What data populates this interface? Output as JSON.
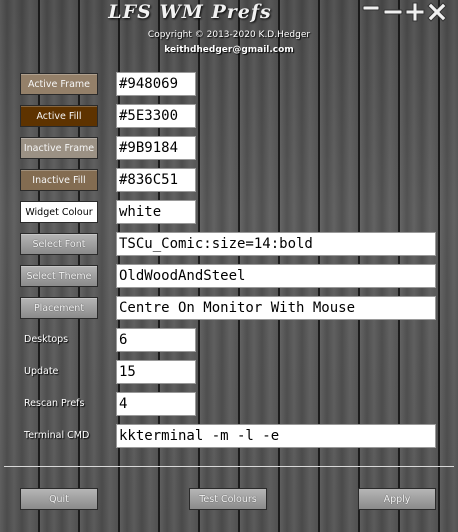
{
  "window": {
    "title": "LFS WM Prefs",
    "controls": [
      "minimize-icon",
      "shade-icon",
      "maximize-icon",
      "close-icon"
    ]
  },
  "credits": {
    "copyright": "Copyright © 2013-2020  K.D.Hedger",
    "email": "keithdhedger@gmail.com"
  },
  "colors": {
    "active_frame": "#948069",
    "active_fill": "#5E3300",
    "inactive_frame": "#9B9184",
    "inactive_fill": "#836C51",
    "widget_colour": "#ffffff",
    "button_grey": "#a0a0a0"
  },
  "rows": {
    "active_frame": {
      "label": "Active Frame",
      "value": "#948069"
    },
    "active_fill": {
      "label": "Active Fill",
      "value": "#5E3300"
    },
    "inactive_frame": {
      "label": "Inactive Frame",
      "value": "#9B9184"
    },
    "inactive_fill": {
      "label": "Inactive Fill",
      "value": "#836C51"
    },
    "widget_colour": {
      "label": "Widget Colour",
      "value": "white"
    },
    "select_font": {
      "label": "Select Font",
      "value": "TSCu_Comic:size=14:bold"
    },
    "select_theme": {
      "label": "Select Theme",
      "value": "OldWoodAndSteel"
    },
    "placement": {
      "label": "Placement",
      "value": "Centre On Monitor With Mouse"
    },
    "desktops": {
      "label": "Desktops",
      "value": "6"
    },
    "update": {
      "label": "Update",
      "value": "15"
    },
    "rescan_prefs": {
      "label": "Rescan Prefs",
      "value": "4"
    },
    "terminal_cmd": {
      "label": "Terminal CMD",
      "value": "kkterminal  -m  -l -e"
    }
  },
  "footer": {
    "quit": "Quit",
    "test_colours": "Test Colours",
    "apply": "Apply"
  }
}
